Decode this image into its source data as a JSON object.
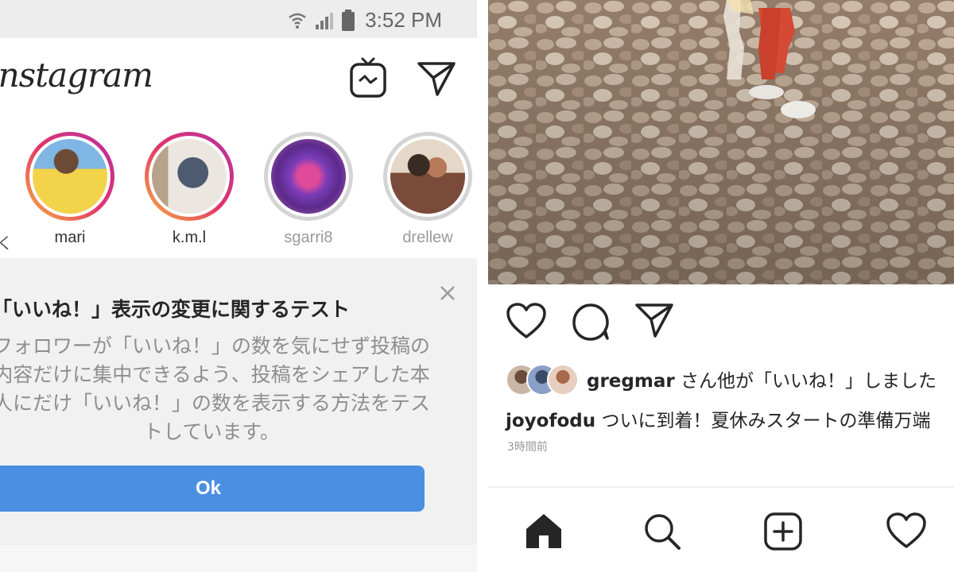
{
  "status_bar": {
    "time": "3:52 PM"
  },
  "header": {
    "logo": "Instagram"
  },
  "stories": [
    {
      "name": "mari",
      "seen": false
    },
    {
      "name": "k.m.l",
      "seen": false
    },
    {
      "name": "sgarri8",
      "seen": true
    },
    {
      "name": "drellew",
      "seen": true
    }
  ],
  "notice": {
    "title": "「いいね！」表示の変更に関するテスト",
    "body": "フォロワーが「いいね！」の数を気にせず投稿の内容だけに集中できるよう、投稿をシェアした本人にだけ「いいね！」の数を表示する方法をテストしています。",
    "ok_label": "Ok"
  },
  "post": {
    "liked_by_user": "gregmar",
    "liked_suffix": "さん他が「いいね！」しました",
    "caption_user": "joyofodu",
    "caption_text": "ついに到着！夏休みスタートの準備万端",
    "time_ago": "3時間前"
  },
  "colors": {
    "ok_button": "#4b8fe3",
    "story_ring_unseen": "#e2336b",
    "story_ring_seen": "#d4d4d4"
  },
  "icons": [
    "wifi-icon",
    "signal-icon",
    "battery-icon",
    "igtv-icon",
    "direct-message-icon",
    "close-icon",
    "heart-icon",
    "comment-icon",
    "share-icon",
    "home-icon",
    "search-icon",
    "add-post-icon",
    "activity-icon"
  ]
}
